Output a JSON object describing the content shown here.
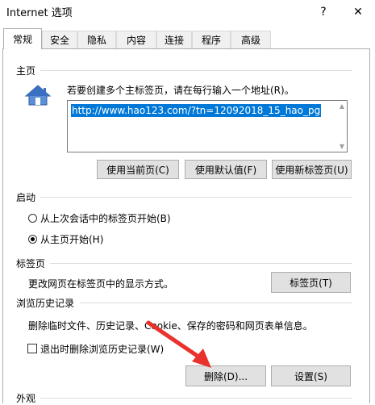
{
  "window": {
    "title": "Internet 选项",
    "help": "?",
    "close": "✕"
  },
  "tabs": [
    {
      "label": "常规"
    },
    {
      "label": "安全"
    },
    {
      "label": "隐私"
    },
    {
      "label": "内容"
    },
    {
      "label": "连接"
    },
    {
      "label": "程序"
    },
    {
      "label": "高级"
    }
  ],
  "home": {
    "heading": "主页",
    "instruction": "若要创建多个主标签页，请在每行输入一个地址(R)。",
    "url": "http://www.hao123.com/?tn=12092018_15_hao_pg",
    "btn_current": "使用当前页(C)",
    "btn_default": "使用默认值(F)",
    "btn_newtab": "使用新标签页(U)"
  },
  "startup": {
    "heading": "启动",
    "option1": "从上次会话中的标签页开始(B)",
    "option2": "从主页开始(H)",
    "selected": 2
  },
  "tabsection": {
    "heading": "标签页",
    "text": "更改网页在标签页中的显示方式。",
    "btn": "标签页(T)"
  },
  "history": {
    "heading": "浏览历史记录",
    "text": "删除临时文件、历史记录、Cookie、保存的密码和网页表单信息。",
    "checkbox_label": "退出时删除浏览历史记录(W)",
    "checked": false,
    "btn_delete": "删除(D)...",
    "btn_settings": "设置(S)"
  },
  "appearance": {
    "heading": "外观"
  },
  "colors": {
    "arrow": "#e8322b",
    "selection": "#0078d7"
  }
}
